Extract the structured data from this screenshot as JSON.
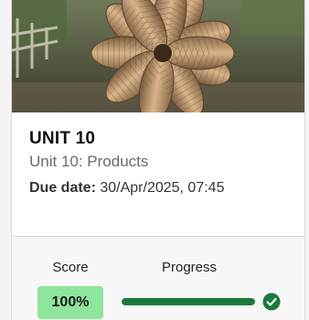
{
  "card": {
    "image_icon": "unit-cover-photo",
    "title": "UNIT 10",
    "subtitle": "Unit 10: Products",
    "due_label": "Due date:",
    "due_value": "30/Apr/2025, 07:45"
  },
  "stats": {
    "score_header": "Score",
    "progress_header": "Progress",
    "score_value": "100%",
    "progress_fraction": 1.0,
    "complete_icon": "check-circle-icon"
  },
  "colors": {
    "score_badge": "#8ee59c",
    "progress_fill": "#1a7a3c",
    "check": "#1a7a3c"
  }
}
